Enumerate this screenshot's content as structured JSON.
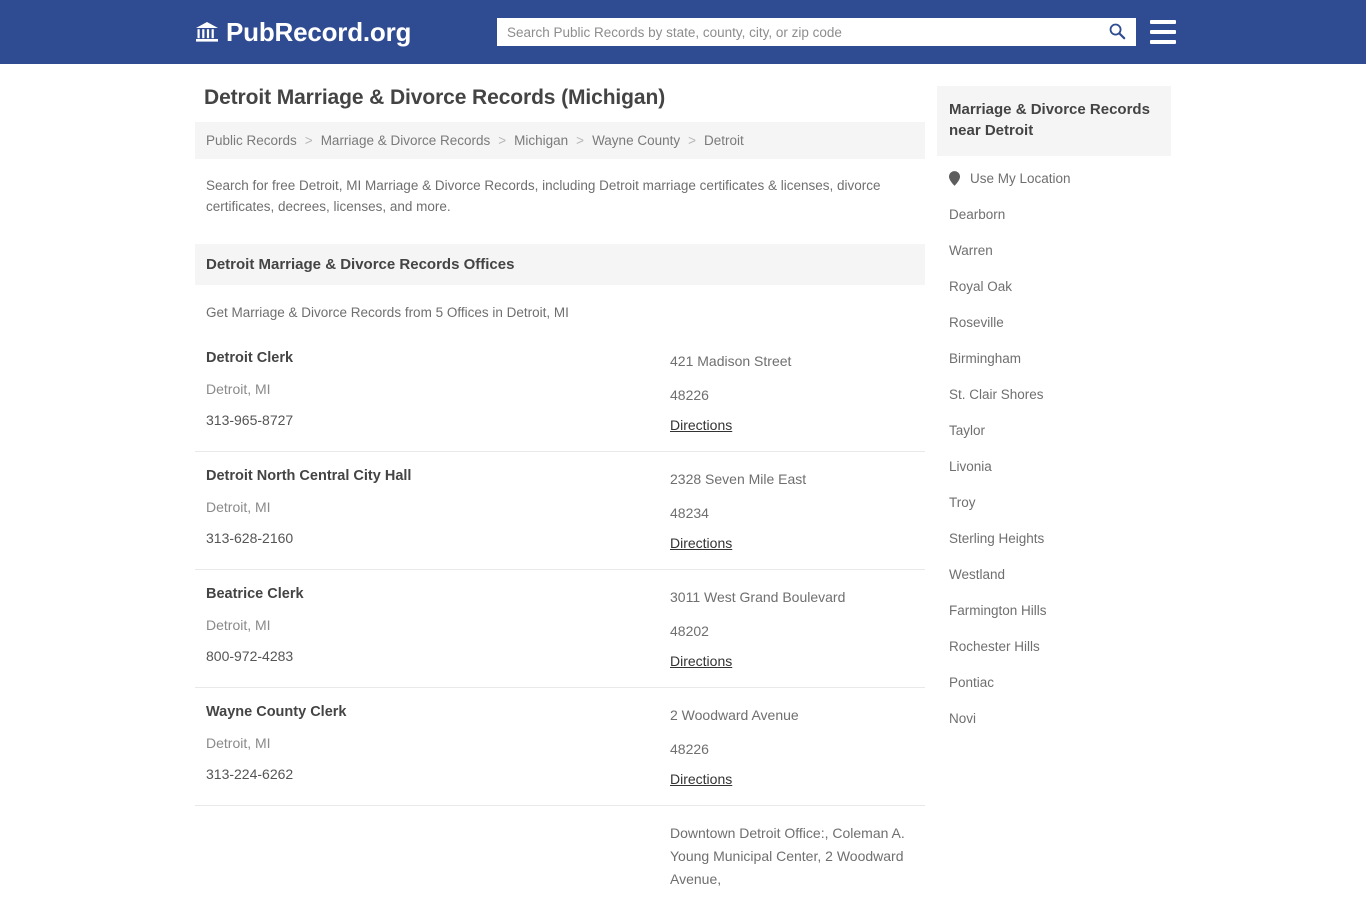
{
  "header": {
    "brand_name": "PubRecord.org",
    "brand_icon": "bank-building-icon",
    "search_placeholder": "Search Public Records by state, county, city, or zip code",
    "search_value": "",
    "search_icon": "search-icon",
    "menu_icon": "hamburger-menu-icon",
    "accent_color": "#2f4b91"
  },
  "main": {
    "title": "Detroit Marriage & Divorce Records (Michigan)",
    "breadcrumb": [
      "Public Records",
      "Marriage & Divorce Records",
      "Michigan",
      "Wayne County",
      "Detroit"
    ],
    "breadcrumb_separator": ">",
    "intro": "Search for free Detroit, MI Marriage & Divorce Records, including Detroit marriage certificates & licenses, divorce certificates, decrees, licenses, and more.",
    "section_title": "Detroit Marriage & Divorce Records Offices",
    "section_subtitle": "Get Marriage & Divorce Records from 5 Offices in Detroit, MI",
    "directions_label": "Directions",
    "offices": [
      {
        "name": "Detroit Clerk",
        "city": "Detroit, MI",
        "phone": "313-965-8727",
        "street": "421 Madison Street",
        "zip": "48226",
        "directions": "Directions"
      },
      {
        "name": "Detroit North Central City Hall",
        "city": "Detroit, MI",
        "phone": "313-628-2160",
        "street": "2328 Seven Mile East",
        "zip": "48234",
        "directions": "Directions"
      },
      {
        "name": "Beatrice Clerk",
        "city": "Detroit, MI",
        "phone": "800-972-4283",
        "street": "3011 West Grand Boulevard",
        "zip": "48202",
        "directions": "Directions"
      },
      {
        "name": "Wayne County Clerk",
        "city": "Detroit, MI",
        "phone": "313-224-6262",
        "street": "2 Woodward Avenue",
        "zip": "48226",
        "directions": "Directions"
      },
      {
        "name": "",
        "city": "",
        "phone": "",
        "street": "Downtown Detroit Office:, Coleman A. Young Municipal Center, 2 Woodward Avenue,",
        "zip": "",
        "directions": ""
      }
    ]
  },
  "sidebar": {
    "title": "Marriage & Divorce Records near Detroit",
    "location_icon": "map-pin-icon",
    "items": [
      "Use My Location",
      "Dearborn",
      "Warren",
      "Royal Oak",
      "Roseville",
      "Birmingham",
      "St. Clair Shores",
      "Taylor",
      "Livonia",
      "Troy",
      "Sterling Heights",
      "Westland",
      "Farmington Hills",
      "Rochester Hills",
      "Pontiac",
      "Novi"
    ]
  }
}
